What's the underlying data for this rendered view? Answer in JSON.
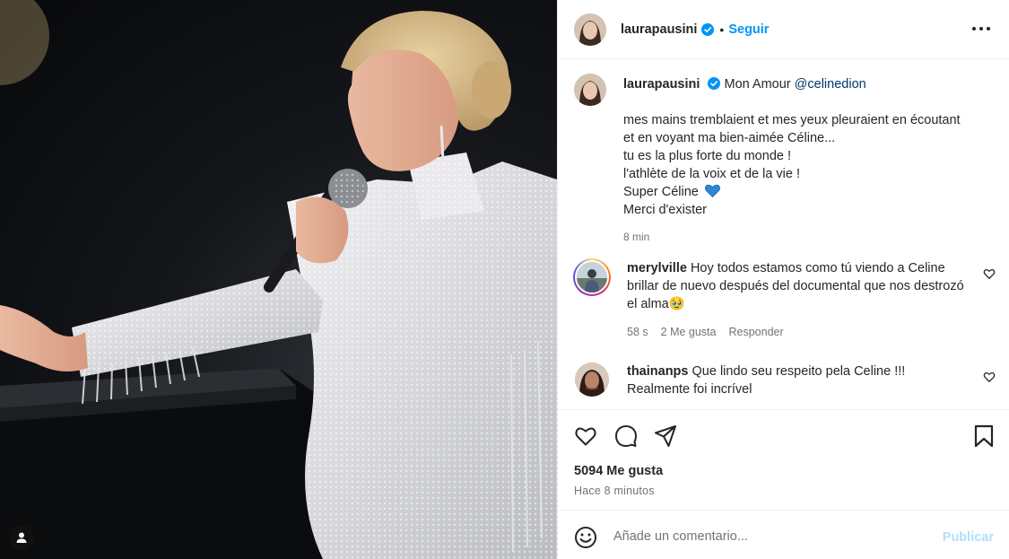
{
  "post": {
    "author": "laurapausini",
    "follow_label": "Seguir",
    "separator": "•"
  },
  "caption": {
    "author": "laurapausini",
    "title": "Mon Amour",
    "mention": "@celinedion",
    "lines": [
      "mes mains tremblaient et mes yeux pleuraient en écoutant",
      "et en voyant ma bien-aimée Céline...",
      "tu es la plus forte du monde !",
      "l'athlète de la voix et de la vie !",
      "Super Céline",
      "Merci d'exister"
    ],
    "time": "8 min"
  },
  "comments": [
    {
      "author": "merylville",
      "text": "Hoy todos estamos como tú viendo a Celine brillar de nuevo después del documental que nos destrozó el alma🥹",
      "time": "58 s",
      "likes": "2 Me gusta",
      "reply": "Responder"
    },
    {
      "author": "thainanps",
      "text": "Que lindo seu respeito pela Celine !!! Realmente foi incrível"
    }
  ],
  "stats": {
    "likes": "5094 Me gusta",
    "ago": "Hace 8 minutos"
  },
  "composer": {
    "placeholder": "Añade un comentario...",
    "publish_label": "Publicar"
  },
  "icons": {
    "verified": "verified-badge-icon",
    "more": "more-options-icon",
    "like": "heart-icon",
    "comment": "comment-bubble-icon",
    "share": "paper-plane-icon",
    "save": "bookmark-icon",
    "emoji": "emoji-smile-icon",
    "tag": "user-tag-icon"
  },
  "colors": {
    "accent": "#0095f6",
    "verified": "#0095f6",
    "publish_disabled": "#b2dffc",
    "mention": "#00376b",
    "muted": "#737373"
  }
}
